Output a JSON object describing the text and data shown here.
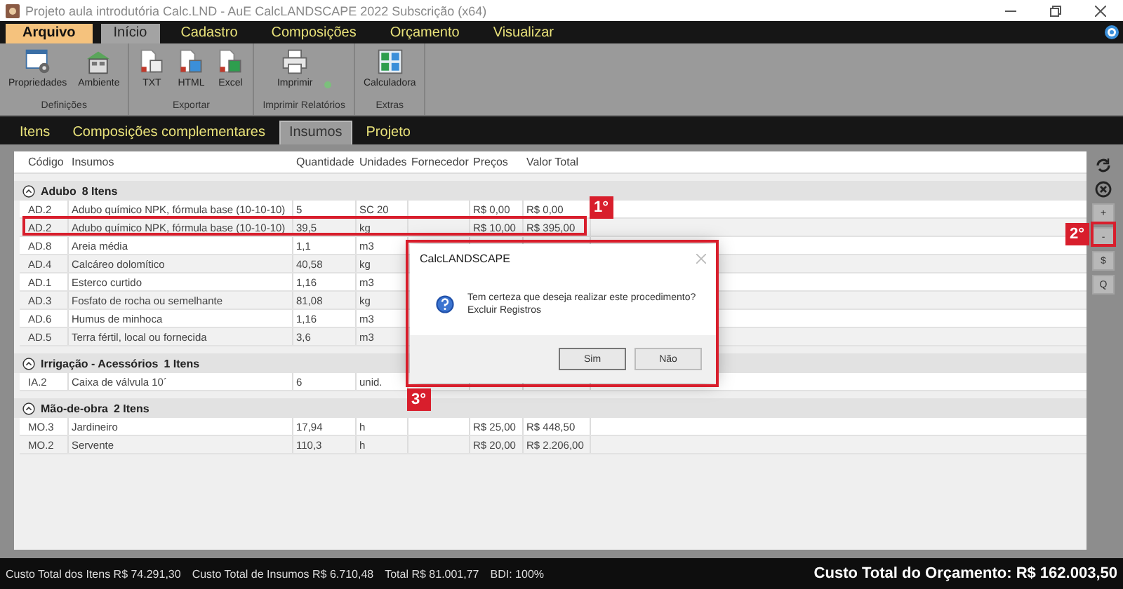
{
  "window": {
    "title": "Projeto aula introdutória Calc.LND - AuE CalcLANDSCAPE 2022 Subscrição (x64)"
  },
  "menu": [
    {
      "label": "Arquivo",
      "kind": "file",
      "selected": false
    },
    {
      "label": "Início",
      "kind": "tab",
      "selected": true
    },
    {
      "label": "Cadastro",
      "kind": "tab",
      "selected": false
    },
    {
      "label": "Composições",
      "kind": "tab",
      "selected": false
    },
    {
      "label": "Orçamento",
      "kind": "tab",
      "selected": false
    },
    {
      "label": "Visualizar",
      "kind": "tab",
      "selected": false
    }
  ],
  "ribbon": [
    {
      "label": "Definições",
      "buttons": [
        {
          "label": "Propriedades"
        },
        {
          "label": "Ambiente"
        }
      ]
    },
    {
      "label": "Exportar",
      "buttons": [
        {
          "label": "TXT"
        },
        {
          "label": "HTML"
        },
        {
          "label": "Excel"
        }
      ]
    },
    {
      "label": "Imprimir Relatórios",
      "buttons": [
        {
          "label": "Imprimir",
          "dropdown": true
        }
      ]
    },
    {
      "label": "Extras",
      "buttons": [
        {
          "label": "Calculadora"
        }
      ]
    }
  ],
  "tabs": [
    {
      "label": "Itens",
      "selected": false
    },
    {
      "label": "Composições complementares",
      "selected": false
    },
    {
      "label": "Insumos",
      "selected": true
    },
    {
      "label": "Projeto",
      "selected": false
    }
  ],
  "table": {
    "columns": [
      "Código",
      "Insumos",
      "Quantidade",
      "Unidades",
      "Fornecedor",
      "Preços",
      "Valor Total"
    ],
    "groups": [
      {
        "name": "Adubo",
        "count": "8 Itens",
        "expanded": true,
        "rows": [
          {
            "code": "AD.2",
            "name": "Adubo químico NPK, fórmula base (10-10-10)",
            "quantity": "5",
            "unit": "SC 20",
            "price": "R$ 0,00",
            "total": "R$ 0,00"
          },
          {
            "code": "AD.2",
            "name": "Adubo químico NPK, fórmula base (10-10-10)",
            "quantity": "39,5",
            "unit": "kg",
            "price": "R$ 10,00",
            "total": "R$ 395,00"
          },
          {
            "code": "AD.8",
            "name": "Areia média",
            "quantity": "1,1",
            "unit": "m3"
          },
          {
            "code": "AD.4",
            "name": "Calcáreo dolomítico",
            "quantity": "40,58",
            "unit": "kg"
          },
          {
            "code": "AD.1",
            "name": "Esterco curtido",
            "quantity": "1,16",
            "unit": "m3"
          },
          {
            "code": "AD.3",
            "name": "Fosfato de rocha ou semelhante",
            "quantity": "81,08",
            "unit": "kg"
          },
          {
            "code": "AD.6",
            "name": "Humus de minhoca",
            "quantity": "1,16",
            "unit": "m3"
          },
          {
            "code": "AD.5",
            "name": "Terra fértil, local ou fornecida",
            "quantity": "3,6",
            "unit": "m3"
          }
        ]
      },
      {
        "name": "Irrigação - Acessórios",
        "count": "1 Itens",
        "expanded": true,
        "rows": [
          {
            "code": "IA.2",
            "name": "Caixa de válvula 10´",
            "quantity": "6",
            "unit": "unid."
          }
        ]
      },
      {
        "name": "Mão-de-obra",
        "count": "2 Itens",
        "expanded": true,
        "rows": [
          {
            "code": "MO.3",
            "name": "Jardineiro",
            "quantity": "17,94",
            "unit": "h",
            "price": "R$ 25,00",
            "total": "R$ 448,50"
          },
          {
            "code": "MO.2",
            "name": "Servente",
            "quantity": "110,3",
            "unit": "h",
            "price": "R$ 20,00",
            "total": "R$ 2.206,00"
          }
        ]
      }
    ]
  },
  "side_buttons": [
    {
      "kind": "refresh"
    },
    {
      "kind": "cancel"
    },
    {
      "kind": "text",
      "label": "+"
    },
    {
      "kind": "text",
      "label": "-"
    },
    {
      "kind": "text",
      "label": "$"
    },
    {
      "kind": "text",
      "label": "Q"
    }
  ],
  "dialog": {
    "title": "CalcLANDSCAPE",
    "message": "Tem certeza que deseja realizar este procedimento?",
    "detail": "Excluir Registros",
    "buttons": [
      {
        "label": "Sim",
        "default": true
      },
      {
        "label": "Não",
        "default": false
      }
    ]
  },
  "annotations": [
    {
      "label": "1°"
    },
    {
      "label": "2°"
    },
    {
      "label": "3°"
    }
  ],
  "status_bar": {
    "items": [
      "Custo Total dos Itens R$ 74.291,30",
      "Custo Total de Insumos R$ 6.710,48",
      "Total R$ 81.001,77",
      "BDI: 100%"
    ],
    "total": "Custo Total do Orçamento: R$ 162.003,50"
  }
}
